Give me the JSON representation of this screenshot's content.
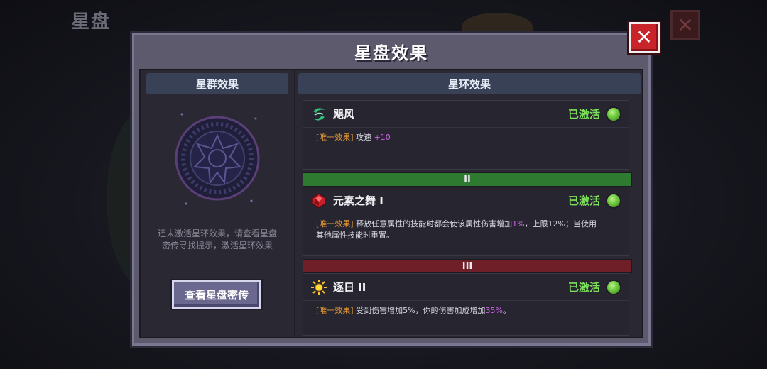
{
  "background": {
    "title": "星盘",
    "close_glyph": "✕"
  },
  "dialog": {
    "title": "星盘效果",
    "close_glyph": "✕"
  },
  "left_panel": {
    "header": "星群效果",
    "hint_lines": [
      "还未激活星环效果，请查看星盘",
      "密传寻找提示，激活星环效果"
    ],
    "button_label": "查看星盘密传"
  },
  "right_panel": {
    "header": "星环效果",
    "effects": [
      {
        "icon": "whirlwind-icon",
        "name": "飓风",
        "status": "已激活",
        "tag": "[唯一效果]",
        "desc_a": "攻速 ",
        "num_a": "+10",
        "desc_b": "",
        "num_b": "",
        "desc_c": ""
      },
      {
        "icon": "red-gem-icon",
        "name": "元素之舞 I",
        "status": "已激活",
        "tag": "[唯一效果]",
        "desc_a": "释放任意属性的技能时都会使该属性伤害增加",
        "num_a": "1%",
        "desc_b": "，上限12%；当使用",
        "desc_c": "其他属性技能时重置。"
      },
      {
        "icon": "sun-icon",
        "name": "逐日 II",
        "status": "已激活",
        "tag": "[唯一效果]",
        "desc_a": "受到伤害增加5%，你的伤害加成增加",
        "num_a": "35%",
        "desc_b": "。"
      }
    ],
    "tiers": [
      {
        "label": "II",
        "color": "#2d7a30"
      },
      {
        "label": "III",
        "color": "#6e1f28"
      }
    ]
  },
  "colors": {
    "active_green": "#7ee05a",
    "tag_orange": "#e89a34",
    "num_purple": "#d060e8",
    "close_red": "#c8242a"
  }
}
